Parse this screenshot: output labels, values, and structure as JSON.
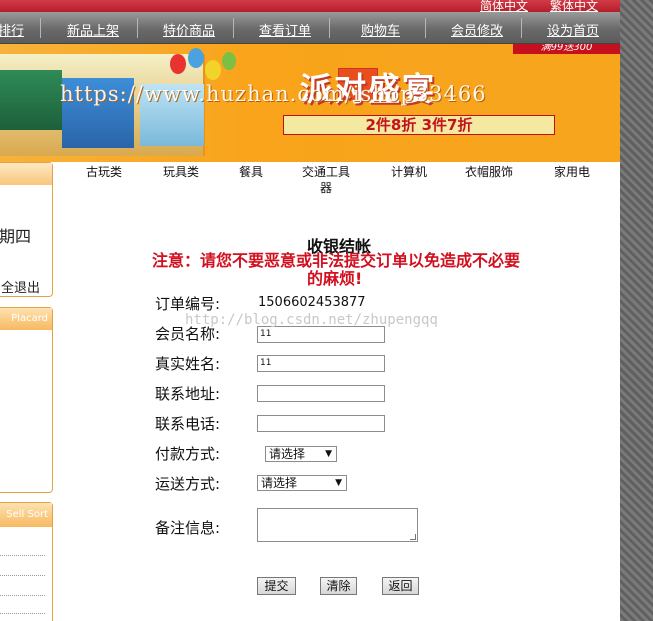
{
  "top_links": [
    "简体中文",
    "繁体中文"
  ],
  "nav": {
    "items": [
      "排行",
      "新品上架",
      "特价商品",
      "查看订单",
      "购物车",
      "会员修改",
      "设为首页"
    ]
  },
  "banner": {
    "watermark": "https://www.huzhan.com/ishop33466",
    "promo_main": "派对盛宴",
    "promo_strip": "2件8折 3件7折",
    "corner_tag": "满99送300"
  },
  "sidebar": {
    "text_1": "期四",
    "text_2": "全退出",
    "panel_1_title": "Placard",
    "panel_2_title": "Sell Sort"
  },
  "categories": [
    "古玩类",
    "玩具类",
    "餐具",
    "交通工具\n器",
    "计算机",
    "衣帽服饰",
    "家用电"
  ],
  "checkout": {
    "title": "收银结帐",
    "warning_line1": "注意：请您不要恶意或非法提交订单以免造成不必要",
    "warning_line2": "的麻烦!",
    "order_no_label": "订单编号:",
    "order_no_value": "1506602453877",
    "member_label": "会员名称:",
    "member_value": "11",
    "realname_label": "真实姓名:",
    "realname_value": "11",
    "address_label": "联系地址:",
    "address_value": "",
    "phone_label": "联系电话:",
    "phone_value": "",
    "payment_label": "付款方式:",
    "payment_selected": "请选择",
    "shipping_label": "运送方式:",
    "shipping_selected": "请选择",
    "remark_label": "备注信息:",
    "submit": "提交",
    "clear": "清除",
    "back": "返回"
  },
  "csdn_watermark": "http://blog.csdn.net/zhupengqq",
  "colors": {
    "nav_bg": "#6a6a6a",
    "top_bar": "#c52a38",
    "warning": "#d11120",
    "banner": "#f9a41b",
    "sidebar_border": "#e4a145"
  }
}
